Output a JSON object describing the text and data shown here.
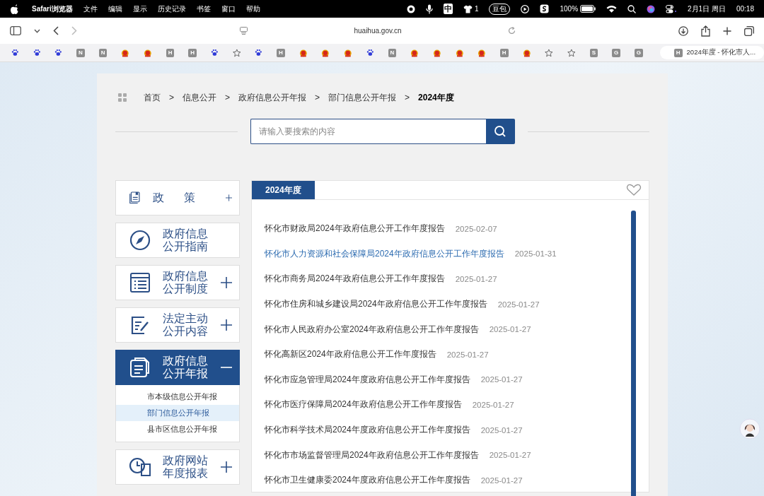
{
  "menu_bar": {
    "app": "Safari浏览器",
    "menus": [
      "文件",
      "编辑",
      "显示",
      "历史记录",
      "书签",
      "窗口",
      "帮助"
    ],
    "status": {
      "input_method": "中",
      "shirt_count": "1",
      "badge": "豆包",
      "battery": "100%",
      "date": "2月1日 周日",
      "time": "00:18"
    }
  },
  "toolbar": {
    "url": "huaihua.gov.cn"
  },
  "bookmarks": [
    {
      "kind": "paw"
    },
    {
      "kind": "paw"
    },
    {
      "kind": "paw"
    },
    {
      "kind": "letter",
      "label": "N"
    },
    {
      "kind": "letter",
      "label": "N"
    },
    {
      "kind": "emblem"
    },
    {
      "kind": "emblem"
    },
    {
      "kind": "letter",
      "label": "H"
    },
    {
      "kind": "letter",
      "label": "H"
    },
    {
      "kind": "paw"
    },
    {
      "kind": "star"
    },
    {
      "kind": "paw"
    },
    {
      "kind": "letter",
      "label": "H"
    },
    {
      "kind": "emblem"
    },
    {
      "kind": "emblem"
    },
    {
      "kind": "emblem"
    },
    {
      "kind": "paw"
    },
    {
      "kind": "letter",
      "label": "N"
    },
    {
      "kind": "emblem"
    },
    {
      "kind": "emblem"
    },
    {
      "kind": "emblem"
    },
    {
      "kind": "emblem"
    },
    {
      "kind": "letter",
      "label": "H"
    },
    {
      "kind": "emblem"
    },
    {
      "kind": "star"
    },
    {
      "kind": "star"
    },
    {
      "kind": "letter",
      "label": "S"
    },
    {
      "kind": "letter",
      "label": "G"
    },
    {
      "kind": "letter",
      "label": "G"
    }
  ],
  "tab": {
    "favicon": "H",
    "title": "2024年度 - 怀化市人..."
  },
  "breadcrumb": [
    {
      "kind": "link",
      "label": "首页"
    },
    {
      "kind": "separator",
      "label": ">"
    },
    {
      "kind": "link",
      "label": "信息公开"
    },
    {
      "kind": "separator",
      "label": ">"
    },
    {
      "kind": "link",
      "label": "政府信息公开年报"
    },
    {
      "kind": "separator",
      "label": ">"
    },
    {
      "kind": "link",
      "label": "部门信息公开年报"
    },
    {
      "kind": "separator",
      "label": ">"
    },
    {
      "kind": "current",
      "label": "2024年度"
    }
  ],
  "search": {
    "placeholder": "请输入要搜索的内容"
  },
  "sidebar": [
    {
      "kind": "book",
      "lines": [
        "政策"
      ],
      "expandable": true,
      "expanded": false,
      "selected": false
    },
    {
      "kind": "compass",
      "lines": [
        "政府信息",
        "公开指南"
      ],
      "expandable": false,
      "expanded": false,
      "selected": false
    },
    {
      "kind": "list",
      "lines": [
        "政府信息",
        "公开制度"
      ],
      "expandable": true,
      "expanded": false,
      "selected": false
    },
    {
      "kind": "edit",
      "lines": [
        "法定主动",
        "公开内容"
      ],
      "expandable": true,
      "expanded": false,
      "selected": false
    },
    {
      "kind": "doc",
      "lines": [
        "政府信息",
        "公开年报"
      ],
      "expandable": true,
      "expanded": true,
      "selected": true,
      "children": [
        {
          "label": "市本级信息公开年报",
          "selected": false
        },
        {
          "label": "部门信息公开年报",
          "selected": true
        },
        {
          "label": "县市区信息公开年报",
          "selected": false
        }
      ]
    },
    {
      "kind": "clock",
      "lines": [
        "政府网站",
        "年度报表"
      ],
      "expandable": true,
      "expanded": false,
      "selected": false
    }
  ],
  "content": {
    "tab": "2024年度",
    "items": [
      {
        "title": "怀化市财政局2024年政府信息公开工作年度报告",
        "date": "2025-02-07",
        "highlighted": false
      },
      {
        "title": "怀化市人力资源和社会保障局2024年政府信息公开工作年度报告",
        "date": "2025-01-31",
        "highlighted": true
      },
      {
        "title": "怀化市商务局2024年政府信息公开工作年度报告",
        "date": "2025-01-27",
        "highlighted": false
      },
      {
        "title": "怀化市住房和城乡建设局2024年政府信息公开工作年度报告",
        "date": "2025-01-27",
        "highlighted": false
      },
      {
        "title": "怀化市人民政府办公室2024年政府信息公开工作年度报告",
        "date": "2025-01-27",
        "highlighted": false
      },
      {
        "title": "怀化高新区2024年政府信息公开工作年度报告",
        "date": "2025-01-27",
        "highlighted": false
      },
      {
        "title": "怀化市应急管理局2024年度政府信息公开工作年度报告",
        "date": "2025-01-27",
        "highlighted": false
      },
      {
        "title": "怀化市医疗保障局2024年政府信息公开工作年度报告",
        "date": "2025-01-27",
        "highlighted": false
      },
      {
        "title": "怀化市科学技术局2024年度政府信息公开工作年度报告",
        "date": "2025-01-27",
        "highlighted": false
      },
      {
        "title": "怀化市市场监督管理局2024年政府信息公开工作年度报告",
        "date": "2025-01-27",
        "highlighted": false
      },
      {
        "title": "怀化市卫生健康委2024年度政府信息公开工作年度报告",
        "date": "2025-01-27",
        "highlighted": false
      }
    ]
  }
}
